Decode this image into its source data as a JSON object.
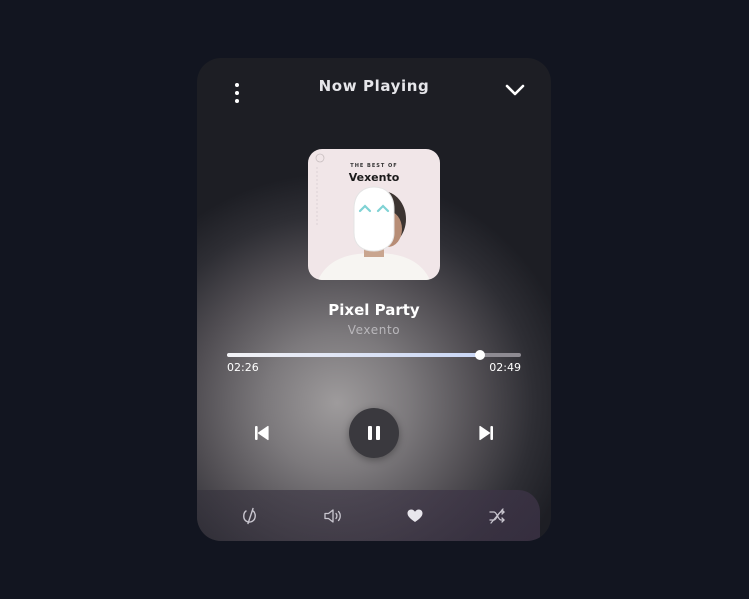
{
  "header": {
    "title": "Now Playing",
    "menu_icon": "more-vertical-icon",
    "collapse_icon": "chevron-down-icon"
  },
  "album_art": {
    "pretitle": "THE BEST OF",
    "artist_name": "Vexento"
  },
  "track": {
    "title": "Pixel Party",
    "artist": "Vexento",
    "current_time": "02:26",
    "total_time": "02:49",
    "progress": 0.86
  },
  "controls": {
    "previous_icon": "skip-previous-icon",
    "pause_icon": "pause-icon",
    "next_icon": "skip-next-icon"
  },
  "bottom_bar": {
    "icons": [
      "repeat-off-icon",
      "volume-icon",
      "heart-icon",
      "shuffle-off-icon"
    ]
  },
  "colors": {
    "background": "#121520",
    "accent": "#c9d6f5"
  }
}
